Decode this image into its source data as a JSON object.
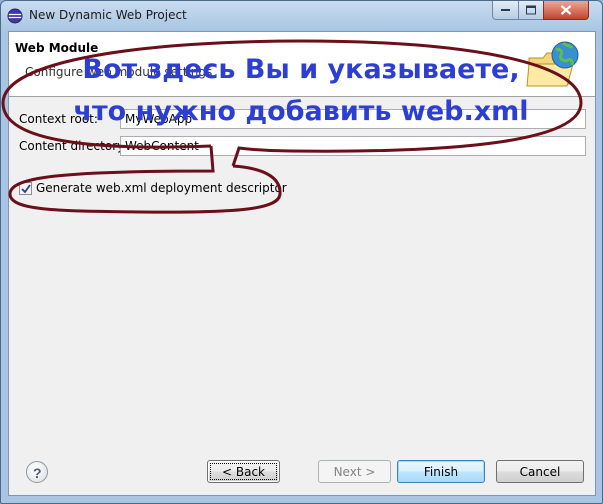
{
  "window": {
    "title": "New Dynamic Web Project",
    "icon": "eclipse-globe-icon",
    "controls": [
      "minimize-icon",
      "maximize-icon",
      "close-icon"
    ]
  },
  "banner": {
    "title": "Web Module",
    "description": "Configure web module settings",
    "icon": "web-project-folder-globe-icon"
  },
  "form": {
    "context_root": {
      "label": "Context root:",
      "value": "MyWebApp"
    },
    "content_directory": {
      "label": "Content directory:",
      "value": "WebContent"
    },
    "generate_webxml": {
      "label": "Generate web.xml deployment descriptor",
      "checked": true
    }
  },
  "annotation": {
    "line1": "Вот здесь Вы и указываете,",
    "line2": "что нужно добавить web.xml",
    "text_color": "#2d3fd3",
    "outline_color": "#6b0f1a"
  },
  "footer": {
    "help_icon": "help-question-icon",
    "help_glyph": "?",
    "back_label": "< Back",
    "next_label": "Next >",
    "finish_label": "Finish",
    "cancel_label": "Cancel"
  }
}
